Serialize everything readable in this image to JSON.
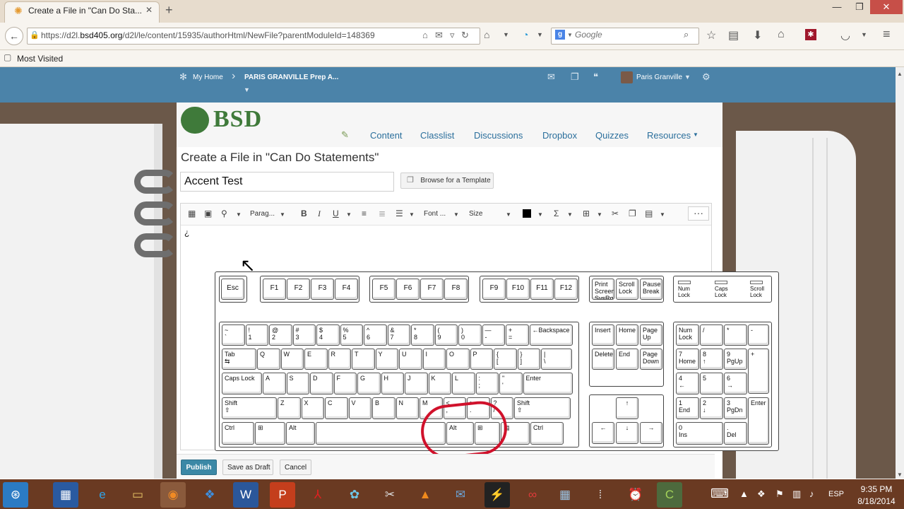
{
  "browser": {
    "tab_title": "Create a File in \"Can Do Sta...",
    "url_prefix": "https://d2l.",
    "url_domain": "bsd405.org",
    "url_path": "/d2l/le/content/15935/authorHtml/NewFile?parentModuleId=148369",
    "search_placeholder": "Google",
    "bookmark_label": "Most Visited"
  },
  "d2l_header": {
    "my_home": "My Home",
    "course": "PARIS GRANVILLE Prep A...",
    "user": "Paris Granville"
  },
  "brand": {
    "logo_text": "BSD",
    "color": "#3f7a3a"
  },
  "course_nav": [
    "Content",
    "Classlist",
    "Discussions",
    "Dropbox",
    "Quizzes",
    "Resources"
  ],
  "page": {
    "title": "Create a File in \"Can Do Statements\"",
    "file_title_value": "Accent Test",
    "browse_label": "Browse for a Template"
  },
  "toolbar": {
    "paragraph": "Parag...",
    "font": "Font ...",
    "size": "Size",
    "more": "···"
  },
  "editor": {
    "content": "¿"
  },
  "keyboard": {
    "function_row": [
      "Esc",
      "F1",
      "F2",
      "F3",
      "F4",
      "F5",
      "F6",
      "F7",
      "F8",
      "F9",
      "F10",
      "F11",
      "F12"
    ],
    "sys_keys": [
      "Print\nScreen\nSysRq",
      "Scroll\nLock",
      "Pause\nBreak"
    ],
    "leds": [
      "Num\nLock",
      "Caps\nLock",
      "Scroll\nLock"
    ],
    "row1": [
      "~\n`",
      "!\n1",
      "@\n2",
      "#\n3",
      "$\n4",
      "%\n5",
      "^\n6",
      "&\n7",
      "*\n8",
      "(\n9",
      ")\n0",
      "—\n-",
      "+\n=",
      "←Backspace"
    ],
    "row2": [
      "Tab\n⇆",
      "Q",
      "W",
      "E",
      "R",
      "T",
      "Y",
      "U",
      "I",
      "O",
      "P",
      "{\n[",
      "}\n]",
      "|\n\\"
    ],
    "row3": [
      "Caps Lock",
      "A",
      "S",
      "D",
      "F",
      "G",
      "H",
      "J",
      "K",
      "L",
      ":\n;",
      "\"\n'",
      "Enter"
    ],
    "row4": [
      "Shift\n⇧",
      "Z",
      "X",
      "C",
      "V",
      "B",
      "N",
      "M",
      "<\n,",
      ">\n.",
      "?\n/",
      "Shift\n⇧"
    ],
    "row5": [
      "Ctrl",
      "⊞",
      "Alt",
      "",
      "Alt",
      "⊞",
      "▤",
      "Ctrl"
    ],
    "nav_cluster": [
      "Insert",
      "Home",
      "Page\nUp",
      "Delete",
      "End",
      "Page\nDown"
    ],
    "arrows": [
      "↑",
      "←",
      "↓",
      "→"
    ],
    "numpad": [
      "Num\nLock",
      "/",
      "*",
      "-",
      "7\nHome",
      "8\n↑",
      "9\nPgUp",
      "+",
      "4\n←",
      "5",
      "6\n→",
      "1\nEnd",
      "2\n↓",
      "3\nPgDn",
      "Enter",
      "0\nIns",
      ".\nDel"
    ]
  },
  "actions": {
    "publish": "Publish",
    "save_draft": "Save as Draft",
    "cancel": "Cancel"
  },
  "taskbar": {
    "lang": "ESP",
    "time": "9:35 PM",
    "date": "8/18/2014"
  },
  "colors": {
    "header": "#4b83a9",
    "taskbar": "#6a3a22",
    "highlight_circle": "#d0112b"
  }
}
